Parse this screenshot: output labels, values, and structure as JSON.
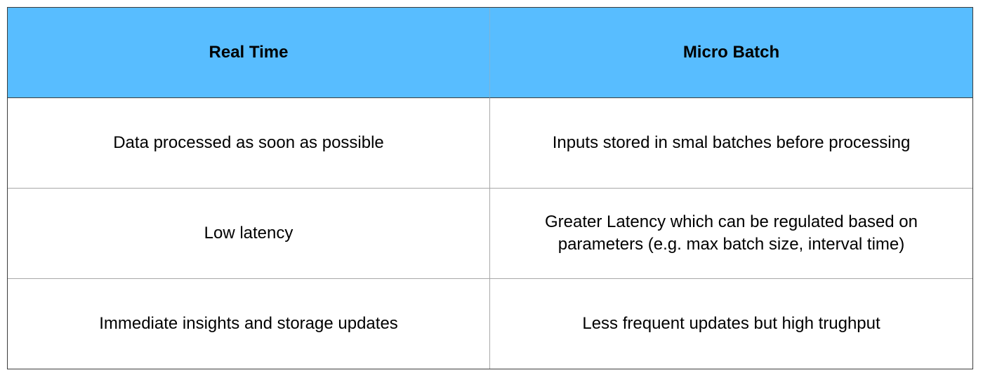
{
  "colors": {
    "header_background": "#58bdff",
    "border": "#3c3c3c",
    "divider": "#a8a8a8",
    "text": "#000000"
  },
  "table": {
    "headers": [
      "Real Time",
      "Micro Batch"
    ],
    "rows": [
      [
        "Data processed as soon as possible",
        "Inputs stored in smal batches before processing"
      ],
      [
        "Low latency",
        "Greater Latency which can be regulated based on parameters (e.g. max batch size, interval time)"
      ],
      [
        "Immediate insights and storage updates",
        "Less frequent updates but high trughput"
      ]
    ]
  }
}
